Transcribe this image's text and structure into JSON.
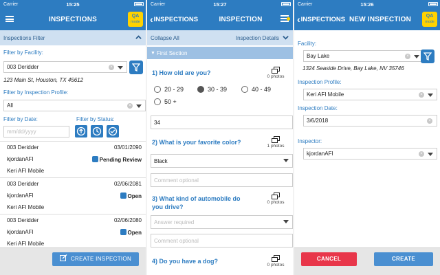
{
  "status": {
    "carrier": "Carrier",
    "times": [
      "15:25",
      "15:27",
      "15:26"
    ]
  },
  "qa": {
    "line1": "QA",
    "line2": "mode"
  },
  "p1": {
    "title": "INSPECTIONS",
    "filter_header": "Inspections Filter",
    "facility_label": "Filter by Facility:",
    "facility_value": "003 Deridder",
    "facility_address": "123 Main St, Houston, TX 45612",
    "profile_label": "Filter by Inspection Profile:",
    "profile_value": "All",
    "date_label": "Filter by Date:",
    "date_placeholder": "mm/dd/yyyy",
    "status_label": "Filter by Status:",
    "rows": [
      {
        "facility": "003 Deridder",
        "date": "03/01/2090",
        "user": "kjordanAFI",
        "status": "Pending Review",
        "profile": "Keri AFI Mobile"
      },
      {
        "facility": "003 Deridder",
        "date": "02/06/2081",
        "user": "kjordanAFI",
        "status": "Open",
        "profile": "Keri AFI Mobile"
      },
      {
        "facility": "003 Deridder",
        "date": "02/06/2080",
        "user": "kjordanAFI",
        "status": "Open",
        "profile": "Keri AFI Mobile"
      }
    ],
    "create_label": "CREATE INSPECTION"
  },
  "p2": {
    "back": "INSPECTIONS",
    "title": "INSPECTION",
    "collapse_all": "Collapse All",
    "details": "Inspection Details",
    "section": "First Section",
    "q1": "1) How old are you?",
    "q1_photos": "0 photos",
    "q1_options": [
      "20 - 29",
      "30 - 39",
      "40 - 49",
      "50 +"
    ],
    "q1_selected": "30 - 39",
    "q1_answer": "34",
    "q2": "2) What is your favorite color?",
    "q2_photos": "1 photos",
    "q2_answer": "Black",
    "q2_comment": "Comment optional",
    "q3_line1": "3) What kind of automobile do",
    "q3_line2": "you drive?",
    "q3_photos": "0 photos",
    "q3_answer": "Answer required",
    "q3_comment": "Comment optional",
    "q4": "4) Do you have a dog?",
    "q4_photos": "0 photos"
  },
  "p3": {
    "back": "INSPECTIONS",
    "title": "NEW INSPECTION",
    "facility_label": "Facility:",
    "facility_value": "Bay Lake",
    "facility_address": "1324 Seaside Drive, Bay Lake, NV 35746",
    "profile_label": "Inspection Profile:",
    "profile_value": "Keri AFI Mobile",
    "date_label": "Inspection Date:",
    "date_value": "3/6/2018",
    "inspector_label": "Inspector:",
    "inspector_value": "kjordanAFI",
    "cancel": "CANCEL",
    "create": "CREATE"
  }
}
